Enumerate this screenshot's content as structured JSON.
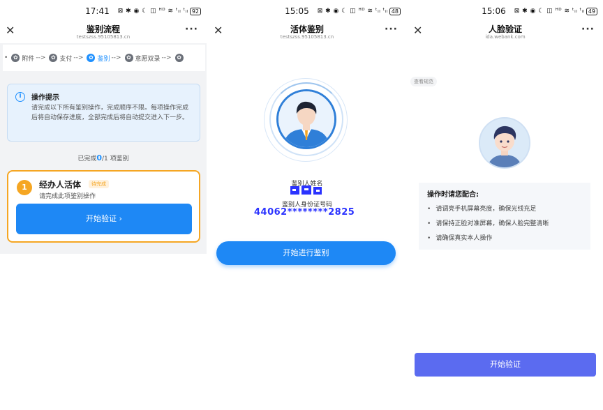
{
  "panel1": {
    "status": {
      "time": "17:41",
      "icons": "⊠ ✱ ◉ ☾ ◫ ᴴᴰ ≋ ᵗᵢₗ ᵗᵢₗ",
      "battery": "92"
    },
    "title": "鉴别流程",
    "subtitle": "testszss.95105813.cn",
    "steps": [
      {
        "label": "附件",
        "active": false
      },
      {
        "label": "支付",
        "active": false
      },
      {
        "label": "鉴别",
        "active": true
      },
      {
        "label": "意愿双录",
        "active": false
      },
      {
        "label": "",
        "active": false
      }
    ],
    "arrow": "-->",
    "tip": {
      "icon": "info-icon",
      "title": "操作提示",
      "body": "请完成以下所有鉴别操作，完成顺序不限。每项操作完成后将自动保存进度，全部完成后将自动提交进入下一步。"
    },
    "progress": {
      "prefix": "已完成",
      "done": "0",
      "total": "/1",
      "suffix": " 项鉴别"
    },
    "card": {
      "number": "1",
      "title": "经办人活体",
      "badge": "待完成",
      "subtitle": "请完成此项鉴别操作",
      "button": "开始验证  ›"
    },
    "colors": {
      "accent": "#1e88f5",
      "warning": "#f5a623",
      "tipBg": "#e7f2fd"
    }
  },
  "panel2": {
    "status": {
      "time": "15:05",
      "icons": "⊠ ✱ ◉ ☾ ◫ ᴴᴰ ≋ ᵗᵢₗ ᵗᵢₗ",
      "battery": "48"
    },
    "title": "活体鉴别",
    "subtitle": "testszss.95105813.cn",
    "name_label": "鉴别人姓名",
    "id_label": "鉴别人身份证号码",
    "id_value": "44062********2825",
    "button": "开始进行鉴别"
  },
  "panel3": {
    "status": {
      "time": "15:06",
      "icons": "⊠ ✱ ◉ ☾ ◫ ᴴᴰ ≋ ᵗᵢₗ ᵗᵢₗ",
      "battery": "49"
    },
    "title": "人脸验证",
    "subtitle": "ida.webank.com",
    "view_spec": "查看规范",
    "notice_title": "操作时请您配合:",
    "notice_items": [
      "请调亮手机屏幕亮度，确保光线充足",
      "请保持正脸对准屏幕，确保人脸完整清晰",
      "请确保真实本人操作"
    ],
    "button": "开始验证",
    "colors": {
      "button": "#5b6bf0"
    }
  }
}
